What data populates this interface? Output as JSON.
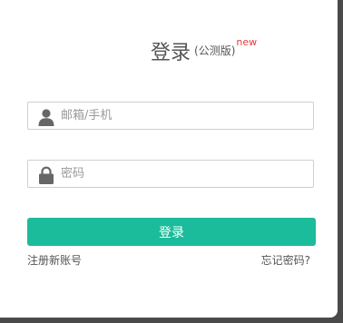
{
  "header": {
    "title": "登录",
    "subtitle": "(公测版)",
    "badge": "new"
  },
  "form": {
    "account": {
      "placeholder": "邮箱/手机",
      "value": "",
      "icon": "user-icon"
    },
    "password": {
      "placeholder": "密码",
      "value": "",
      "icon": "lock-icon"
    },
    "submit_label": "登录"
  },
  "links": {
    "register": "注册新账号",
    "forgot": "忘记密码?"
  },
  "colors": {
    "accent": "#1bbc9b",
    "badge": "#e03c3c",
    "text": "#555555",
    "placeholder": "#999999",
    "icon": "#666666",
    "border": "#cfcfcf"
  }
}
